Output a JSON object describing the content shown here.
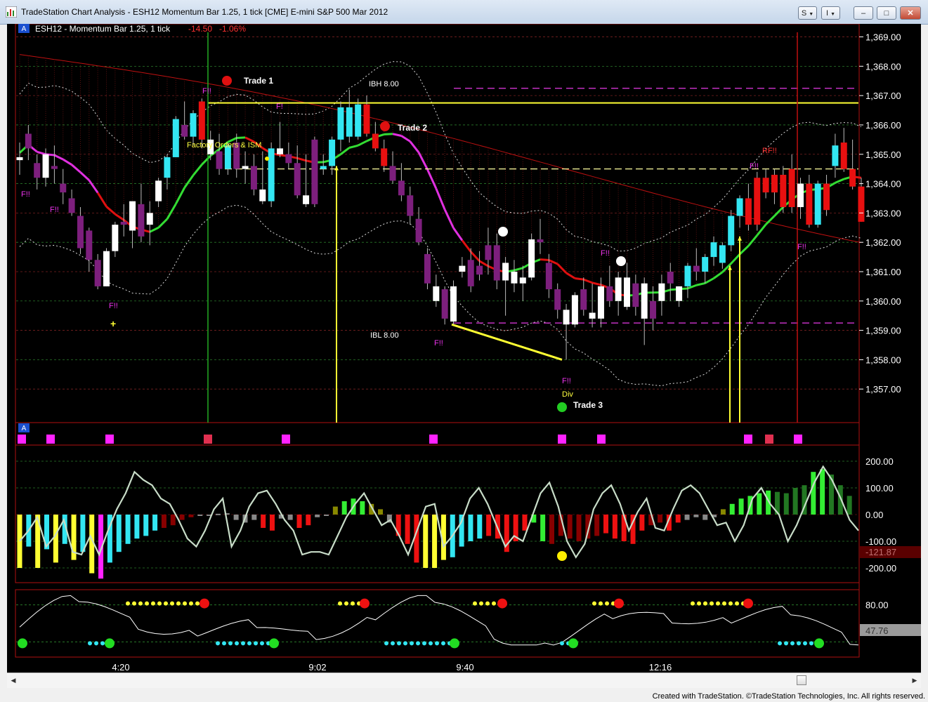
{
  "window": {
    "title": "TradeStation Chart Analysis - ESH12 Momentum Bar 1.25, 1 tick [CME] E-mini S&P 500 Mar 2012",
    "btn_s": "S",
    "btn_i": "I",
    "btn_min": "–",
    "btn_max": "□",
    "btn_close": "✕"
  },
  "header": {
    "badge": "A",
    "symbol": "ESH12 - Momentum Bar 1.25, 1 tick",
    "change": "-14.50",
    "change_pct": "-1.06%",
    "badge2": "A"
  },
  "price_axis": {
    "labels": [
      "1,369.00",
      "1,368.00",
      "1,367.00",
      "1,366.00",
      "1,365.00",
      "1,364.00",
      "1,363.00",
      "1,362.00",
      "1,361.00",
      "1,360.00",
      "1,359.00",
      "1,358.00",
      "1,357.00"
    ],
    "min": 1356.0,
    "max": 1369.3
  },
  "time_axis": {
    "labels": [
      "4:20",
      "9:02",
      "9:40",
      "12:16"
    ]
  },
  "annotations": {
    "trade1": "Trade 1",
    "trade2": "Trade 2",
    "trade3": "Trade 3",
    "ibh": "IBH  8.00",
    "ibl": "IBL  8.00",
    "news": "Factory Orders & ISM",
    "fl": "F!!",
    "rfl": "RF!!",
    "fl_short": "F!",
    "div": "Div"
  },
  "osc1": {
    "labels": [
      "200.00",
      "100.00",
      "0.00",
      "-100.00",
      "-200.00"
    ],
    "value": "-121.87",
    "min": -250,
    "max": 250
  },
  "osc2": {
    "labels": [
      "80.00"
    ],
    "value": "47.76",
    "min": 0,
    "max": 100
  },
  "colors": {
    "cyan": "#33e6f2",
    "purple": "#7d1f7d",
    "red": "#e81010",
    "white": "#ffffff",
    "magenta": "#ff22ff",
    "yellow": "#ffff33",
    "green": "#33ee33"
  },
  "chart_data": {
    "type": "candlestick",
    "bars": [
      [
        1364.8,
        1365.4,
        1364.3,
        1364.9,
        "w"
      ],
      [
        1365.2,
        1366.0,
        1364.8,
        1365.7,
        "p"
      ],
      [
        1364.7,
        1365.0,
        1363.8,
        1364.2,
        "p"
      ],
      [
        1364.2,
        1365.2,
        1363.9,
        1365.0,
        "w"
      ],
      [
        1364.5,
        1365.3,
        1364.0,
        1364.6,
        "p"
      ],
      [
        1364.0,
        1364.5,
        1363.3,
        1363.7,
        "p"
      ],
      [
        1363.5,
        1363.8,
        1362.9,
        1363.0,
        "p"
      ],
      [
        1362.9,
        1363.2,
        1361.6,
        1361.8,
        "p"
      ],
      [
        1362.4,
        1362.5,
        1361.0,
        1361.4,
        "p"
      ],
      [
        1361.4,
        1361.6,
        1360.4,
        1360.5,
        "p"
      ],
      [
        1360.5,
        1361.8,
        1360.5,
        1361.7,
        "w"
      ],
      [
        1361.7,
        1362.7,
        1361.5,
        1362.6,
        "w"
      ],
      [
        1362.7,
        1363.3,
        1362.2,
        1362.6,
        "p"
      ],
      [
        1362.4,
        1363.4,
        1361.8,
        1363.4,
        "w"
      ],
      [
        1363.3,
        1364.0,
        1362.0,
        1362.2,
        "p"
      ],
      [
        1362.6,
        1363.4,
        1361.9,
        1363.0,
        "w"
      ],
      [
        1363.4,
        1364.2,
        1363.2,
        1364.1,
        "w"
      ],
      [
        1364.2,
        1365.0,
        1363.8,
        1364.9,
        "c"
      ],
      [
        1364.9,
        1366.3,
        1364.9,
        1366.2,
        "c"
      ],
      [
        1366.0,
        1366.8,
        1365.5,
        1365.6,
        "p"
      ],
      [
        1365.6,
        1366.5,
        1365.3,
        1366.4,
        "c"
      ],
      [
        1366.8,
        1366.9,
        1365.2,
        1365.5,
        "r"
      ],
      [
        1365.5,
        1365.8,
        1364.8,
        1365.0,
        "w"
      ],
      [
        1365.1,
        1365.7,
        1364.3,
        1364.5,
        "p"
      ],
      [
        1364.5,
        1365.4,
        1364.3,
        1365.3,
        "c"
      ],
      [
        1365.4,
        1365.7,
        1364.2,
        1364.5,
        "p"
      ],
      [
        1364.5,
        1365.1,
        1364.0,
        1364.6,
        "w"
      ],
      [
        1364.6,
        1365.0,
        1363.6,
        1363.8,
        "p"
      ],
      [
        1363.8,
        1365.1,
        1363.3,
        1363.4,
        "w"
      ],
      [
        1363.4,
        1365.4,
        1363.2,
        1365.2,
        "c"
      ],
      [
        1365.2,
        1366.1,
        1364.9,
        1365.0,
        "w"
      ],
      [
        1365.0,
        1365.4,
        1364.5,
        1364.7,
        "p"
      ],
      [
        1364.7,
        1365.3,
        1363.5,
        1363.6,
        "p"
      ],
      [
        1363.6,
        1365.0,
        1363.2,
        1363.3,
        "w"
      ],
      [
        1363.3,
        1365.6,
        1363.2,
        1365.5,
        "p"
      ],
      [
        1364.5,
        1365.0,
        1364.3,
        1364.6,
        "c"
      ],
      [
        1364.6,
        1365.6,
        1364.3,
        1365.5,
        "c"
      ],
      [
        1365.5,
        1366.8,
        1365.1,
        1366.6,
        "c"
      ],
      [
        1366.6,
        1367.2,
        1365.4,
        1365.6,
        "c"
      ],
      [
        1365.6,
        1366.9,
        1365.5,
        1366.7,
        "c"
      ],
      [
        1366.7,
        1367.0,
        1365.6,
        1365.7,
        "r"
      ],
      [
        1365.7,
        1366.1,
        1365.1,
        1365.2,
        "r"
      ],
      [
        1365.2,
        1365.5,
        1364.4,
        1364.6,
        "r"
      ],
      [
        1364.6,
        1365.1,
        1364.0,
        1364.1,
        "p"
      ],
      [
        1364.1,
        1364.7,
        1363.4,
        1363.6,
        "p"
      ],
      [
        1363.6,
        1363.9,
        1362.6,
        1362.9,
        "p"
      ],
      [
        1362.8,
        1363.2,
        1361.9,
        1362.0,
        "p"
      ],
      [
        1361.6,
        1361.8,
        1360.4,
        1360.6,
        "p"
      ],
      [
        1360.5,
        1360.9,
        1359.8,
        1360.0,
        "w"
      ],
      [
        1360.4,
        1360.5,
        1359.2,
        1359.4,
        "p"
      ],
      [
        1360.5,
        1360.7,
        1359.2,
        1359.3,
        "w"
      ],
      [
        1361.0,
        1361.5,
        1360.8,
        1361.2,
        "w"
      ],
      [
        1361.4,
        1361.8,
        1360.3,
        1360.5,
        "p"
      ],
      [
        1361.2,
        1361.7,
        1360.7,
        1360.9,
        "p"
      ],
      [
        1361.4,
        1362.5,
        1360.9,
        1361.9,
        "p"
      ],
      [
        1361.9,
        1362.3,
        1360.4,
        1360.7,
        "p"
      ],
      [
        1360.7,
        1361.5,
        1359.5,
        1361.3,
        "w"
      ],
      [
        1361.0,
        1361.4,
        1360.3,
        1360.6,
        "w"
      ],
      [
        1360.6,
        1361.2,
        1360.0,
        1360.8,
        "w"
      ],
      [
        1360.8,
        1362.3,
        1360.7,
        1362.1,
        "w"
      ],
      [
        1362.1,
        1362.8,
        1361.6,
        1362.0,
        "p"
      ],
      [
        1361.3,
        1361.6,
        1360.1,
        1360.4,
        "p"
      ],
      [
        1360.4,
        1360.6,
        1359.4,
        1359.7,
        "p"
      ],
      [
        1359.7,
        1359.9,
        1358.0,
        1359.2,
        "w"
      ],
      [
        1359.2,
        1360.3,
        1359.1,
        1360.2,
        "w"
      ],
      [
        1360.4,
        1360.8,
        1359.5,
        1359.7,
        "p"
      ],
      [
        1359.6,
        1360.6,
        1359.1,
        1359.4,
        "w"
      ],
      [
        1359.4,
        1360.8,
        1359.1,
        1360.5,
        "w"
      ],
      [
        1360.5,
        1361.2,
        1359.8,
        1360.0,
        "p"
      ],
      [
        1360.0,
        1361.0,
        1359.5,
        1360.8,
        "w"
      ],
      [
        1360.8,
        1361.3,
        1359.7,
        1359.8,
        "w"
      ],
      [
        1359.8,
        1360.9,
        1359.5,
        1360.6,
        "p"
      ],
      [
        1360.6,
        1360.8,
        1358.5,
        1359.4,
        "w"
      ],
      [
        1359.4,
        1360.5,
        1359.0,
        1360.0,
        "p"
      ],
      [
        1360.0,
        1360.9,
        1359.5,
        1360.6,
        "w"
      ],
      [
        1360.6,
        1361.3,
        1360.0,
        1361.0,
        "p"
      ],
      [
        1360.0,
        1360.5,
        1359.8,
        1360.5,
        "w"
      ],
      [
        1360.5,
        1361.3,
        1360.1,
        1361.2,
        "c"
      ],
      [
        1361.2,
        1361.8,
        1360.7,
        1361.0,
        "p"
      ],
      [
        1361.0,
        1361.6,
        1360.6,
        1361.5,
        "c"
      ],
      [
        1361.5,
        1362.2,
        1361.2,
        1362.0,
        "c"
      ],
      [
        1361.3,
        1362.0,
        1361.1,
        1361.9,
        "c"
      ],
      [
        1361.9,
        1363.1,
        1361.7,
        1362.9,
        "c"
      ],
      [
        1362.9,
        1363.6,
        1362.5,
        1363.5,
        "c"
      ],
      [
        1363.5,
        1364.0,
        1362.4,
        1362.6,
        "r"
      ],
      [
        1362.6,
        1364.4,
        1362.4,
        1364.2,
        "r"
      ],
      [
        1364.2,
        1364.5,
        1363.5,
        1363.7,
        "r"
      ],
      [
        1363.7,
        1364.5,
        1363.3,
        1364.3,
        "r"
      ],
      [
        1364.3,
        1364.6,
        1363.0,
        1363.2,
        "r"
      ],
      [
        1363.2,
        1365.0,
        1363.0,
        1364.5,
        "r"
      ],
      [
        1363.2,
        1364.2,
        1362.8,
        1364.0,
        "w"
      ],
      [
        1364.0,
        1364.3,
        1362.5,
        1362.6,
        "r"
      ],
      [
        1362.6,
        1364.1,
        1362.5,
        1364.0,
        "c"
      ],
      [
        1364.0,
        1364.3,
        1362.9,
        1363.1,
        "r"
      ],
      [
        1364.6,
        1365.7,
        1364.2,
        1365.3,
        "c"
      ],
      [
        1365.4,
        1365.9,
        1364.4,
        1364.5,
        "r"
      ],
      [
        1364.5,
        1365.5,
        1363.8,
        1363.9,
        "r"
      ],
      [
        1363.9,
        1364.2,
        1362.7,
        1362.7,
        "r"
      ]
    ],
    "histogram": [
      [
        -200,
        "y"
      ],
      [
        -120,
        "c"
      ],
      [
        -200,
        "y"
      ],
      [
        -130,
        "c"
      ],
      [
        -180,
        "y"
      ],
      [
        -110,
        "c"
      ],
      [
        -170,
        "y"
      ],
      [
        -140,
        "c"
      ],
      [
        -220,
        "y"
      ],
      [
        -240,
        "m"
      ],
      [
        -180,
        "c"
      ],
      [
        -140,
        "c"
      ],
      [
        -110,
        "c"
      ],
      [
        -90,
        "c"
      ],
      [
        -80,
        "c"
      ],
      [
        -60,
        "c"
      ],
      [
        -50,
        "d"
      ],
      [
        -40,
        "d"
      ],
      [
        -20,
        "d"
      ],
      [
        -10,
        "d"
      ],
      [
        -5,
        "g"
      ],
      [
        0,
        "g"
      ],
      [
        3,
        "g"
      ],
      [
        5,
        "g"
      ],
      [
        -20,
        "g"
      ],
      [
        -30,
        "g"
      ],
      [
        -20,
        "g"
      ],
      [
        -50,
        "r"
      ],
      [
        -60,
        "r"
      ],
      [
        -15,
        "g"
      ],
      [
        -20,
        "g"
      ],
      [
        -50,
        "r"
      ],
      [
        -40,
        "r"
      ],
      [
        -10,
        "g"
      ],
      [
        -5,
        "g"
      ],
      [
        30,
        "o"
      ],
      [
        50,
        "lg"
      ],
      [
        60,
        "lg"
      ],
      [
        50,
        "lg"
      ],
      [
        40,
        "o"
      ],
      [
        20,
        "o"
      ],
      [
        -30,
        "g"
      ],
      [
        -80,
        "r"
      ],
      [
        -110,
        "r"
      ],
      [
        -180,
        "r"
      ],
      [
        -200,
        "y"
      ],
      [
        -200,
        "y"
      ],
      [
        -170,
        "y"
      ],
      [
        -160,
        "c"
      ],
      [
        -120,
        "c"
      ],
      [
        -100,
        "c"
      ],
      [
        -90,
        "c"
      ],
      [
        -80,
        "r"
      ],
      [
        -90,
        "r"
      ],
      [
        -140,
        "r"
      ],
      [
        -100,
        "r"
      ],
      [
        -60,
        "r"
      ],
      [
        -30,
        "lg"
      ],
      [
        -100,
        "lg"
      ],
      [
        -110,
        "d"
      ],
      [
        -80,
        "d"
      ],
      [
        -90,
        "d"
      ],
      [
        -100,
        "d"
      ],
      [
        -90,
        "d"
      ],
      [
        -80,
        "d"
      ],
      [
        -70,
        "r"
      ],
      [
        -90,
        "r"
      ],
      [
        -100,
        "r"
      ],
      [
        -110,
        "r"
      ],
      [
        -60,
        "r"
      ],
      [
        -40,
        "d"
      ],
      [
        -30,
        "d"
      ],
      [
        -60,
        "r"
      ],
      [
        -30,
        "r"
      ],
      [
        -20,
        "g"
      ],
      [
        -10,
        "g"
      ],
      [
        -20,
        "g"
      ],
      [
        -10,
        "g"
      ],
      [
        20,
        "o"
      ],
      [
        40,
        "lg"
      ],
      [
        60,
        "lg"
      ],
      [
        70,
        "lg"
      ],
      [
        80,
        "lg"
      ],
      [
        90,
        "lg"
      ],
      [
        85,
        "dg"
      ],
      [
        80,
        "dg"
      ],
      [
        100,
        "dg"
      ],
      [
        110,
        "dg"
      ],
      [
        160,
        "lg"
      ],
      [
        170,
        "lg"
      ],
      [
        150,
        "dg"
      ],
      [
        110,
        "dg"
      ],
      [
        70,
        "dg"
      ]
    ],
    "osc_line": [
      -100,
      -60,
      -10,
      -120,
      -80,
      -20,
      -140,
      -150,
      -80,
      -150,
      -60,
      20,
      80,
      160,
      130,
      110,
      60,
      40,
      -20,
      -90,
      -120,
      -60,
      20,
      60,
      -120,
      -60,
      30,
      80,
      90,
      40,
      -20,
      -60,
      -150,
      -140,
      -140,
      -150,
      -80,
      -10,
      40,
      80,
      20,
      -40,
      -20,
      -80,
      -150,
      -60,
      30,
      40,
      -120,
      -80,
      -30,
      60,
      100,
      40,
      -40,
      -120,
      -80,
      -100,
      -10,
      80,
      120,
      30,
      -100,
      -160,
      -110,
      20,
      80,
      110,
      40,
      -60,
      10,
      60,
      -50,
      -60,
      20,
      90,
      110,
      80,
      20,
      -40,
      -30,
      -100,
      -40,
      60,
      100,
      40,
      0,
      -100,
      -40,
      40,
      120,
      180,
      130,
      60,
      -20,
      -60
    ]
  }
}
